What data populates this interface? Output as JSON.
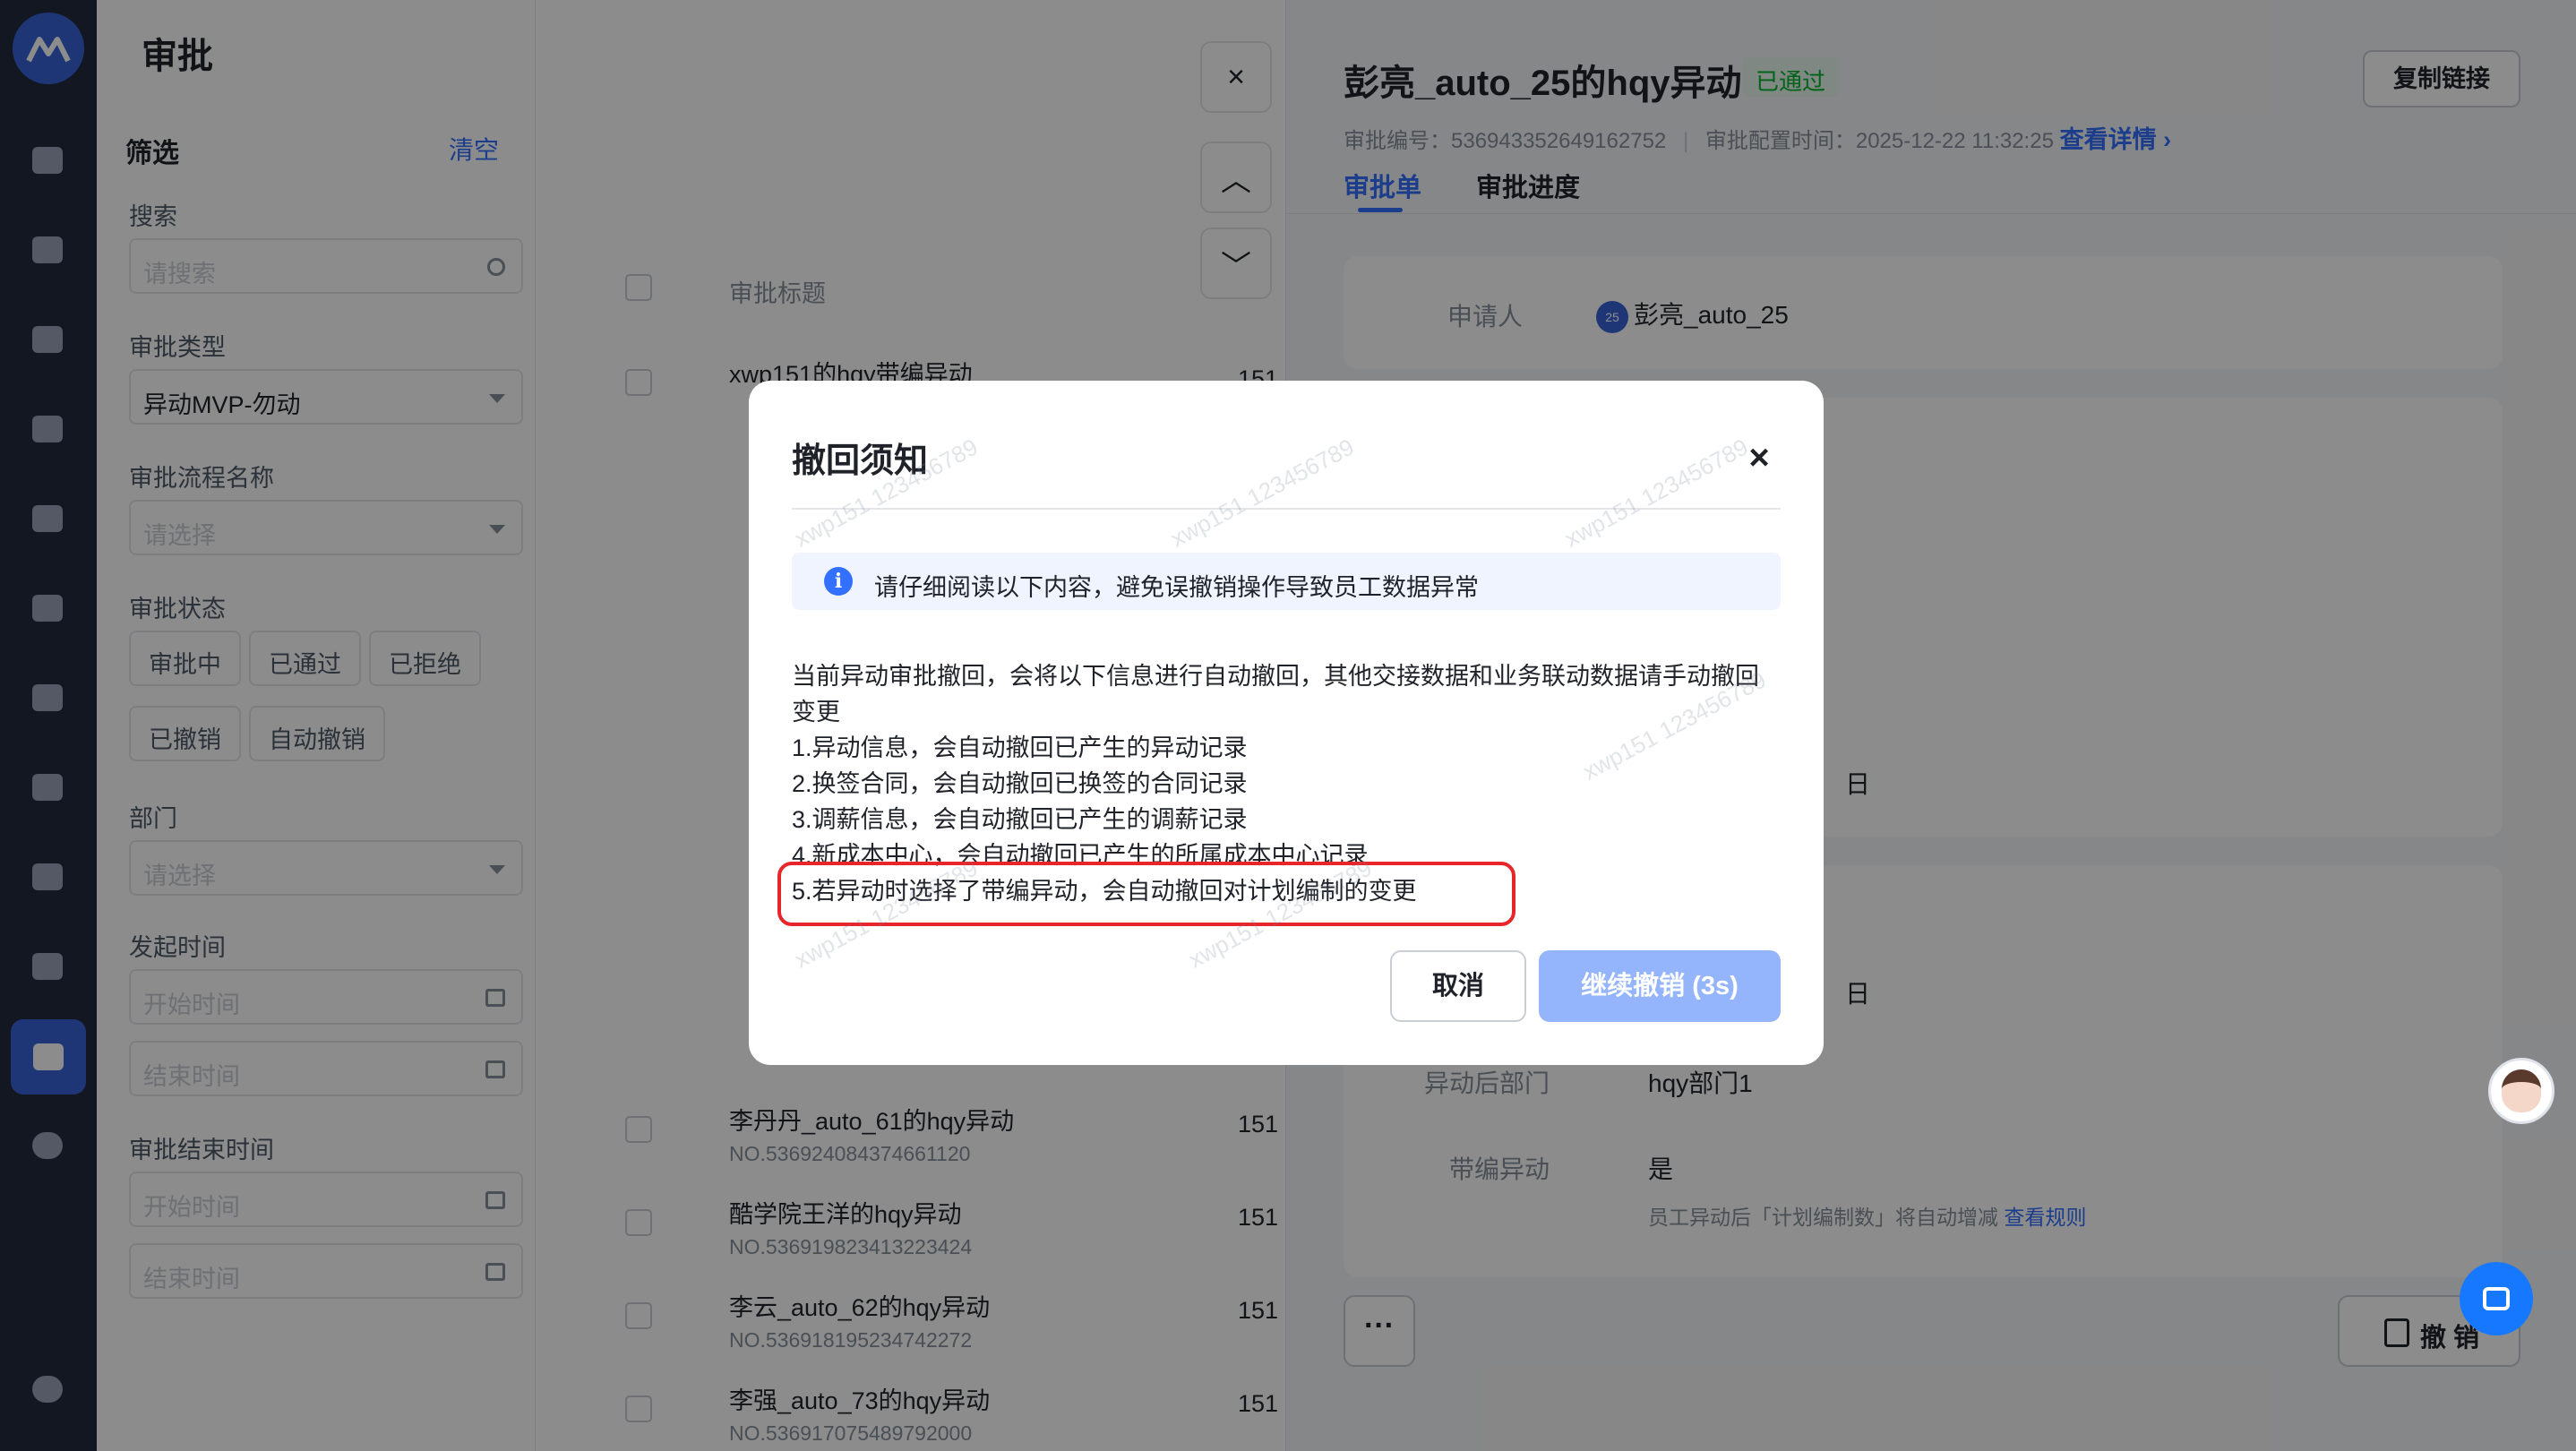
{
  "nav": {
    "items": [
      "home-icon",
      "team-icon",
      "user-icon",
      "org-chart-icon",
      "user-settings-icon",
      "calendar-icon",
      "ticket-icon",
      "report-icon",
      "learning-icon",
      "package-icon",
      "approval-icon",
      "chart-pie-icon",
      "settings-icon"
    ]
  },
  "filter": {
    "title": "审批",
    "heading": "筛选",
    "clear": "清空",
    "search_label": "搜索",
    "search_placeholder": "请搜索",
    "type_label": "审批类型",
    "type_value": "异动MVP-勿动",
    "flow_label": "审批流程名称",
    "flow_placeholder": "请选择",
    "status_label": "审批状态",
    "statuses": [
      "审批中",
      "已通过",
      "已拒绝",
      "已撤销",
      "自动撤销"
    ],
    "dept_label": "部门",
    "dept_placeholder": "请选择",
    "start_label": "发起时间",
    "end_label": "审批结束时间",
    "begin_placeholder": "开始时间",
    "finish_placeholder": "结束时间"
  },
  "list": {
    "column_header": "审批标题",
    "rows": [
      {
        "title": "xwp151的hqy带编异动",
        "no": "",
        "tail": "151"
      },
      {
        "title": "李丹丹_auto_61的hqy异动",
        "no": "NO.536924084374661120",
        "tail": "151"
      },
      {
        "title": "酷学院王洋的hqy异动",
        "no": "NO.536919823413223424",
        "tail": "151"
      },
      {
        "title": "李云_auto_62的hqy异动",
        "no": "NO.536918195234742272",
        "tail": "151"
      },
      {
        "title": "李强_auto_73的hqy异动",
        "no": "NO.536917075489792000",
        "tail": "151"
      }
    ]
  },
  "side_buttons": {
    "close": "×",
    "up": "︿",
    "down": "﹀"
  },
  "detail": {
    "title": "彭亮_auto_25的hqy异动",
    "status_badge": "已通过",
    "copy_link": "复制链接",
    "number_label": "审批编号：",
    "number": "536943352649162752",
    "config_label": "审批配置时间：",
    "config_time": "2025-12-22 11:32:25",
    "view_details": "查看详情",
    "tabs": [
      "审批单",
      "审批进度"
    ],
    "applicant_label": "申请人",
    "applicant_avatar": "25",
    "applicant_name": "彭亮_auto_25",
    "partial_a": "日",
    "partial_b": "日",
    "dept_after_label": "异动后部门",
    "dept_after_value": "hqy部门1",
    "band_label": "带编异动",
    "band_value": "是",
    "band_hint": "员工异动后「计划编制数」将自动增减",
    "band_hint_link": "查看规则",
    "more": "···",
    "revoke": "撤 销"
  },
  "modal": {
    "title": "撤回须知",
    "close": "×",
    "notice": "请仔细阅读以下内容，避免误撤销操作导致员工数据异常",
    "intro": "当前异动审批撤回，会将以下信息进行自动撤回，其他交接数据和业务联动数据请手动撤回变更",
    "items": [
      "1.异动信息，会自动撤回已产生的异动记录",
      "2.换签合同，会自动撤回已换签的合同记录",
      "3.调薪信息，会自动撤回已产生的调薪记录",
      "4.新成本中心，会自动撤回已产生的所属成本中心记录",
      "5.若异动时选择了带编异动，会自动撤回对计划编制的变更"
    ],
    "cancel": "取消",
    "continue": "继续撤销 (3s)"
  },
  "watermark": "xwp151 123456789",
  "colors": {
    "primary": "#3370ff",
    "success": "#00b42a",
    "highlight": "#e8262a",
    "nav": "#232a3f"
  }
}
